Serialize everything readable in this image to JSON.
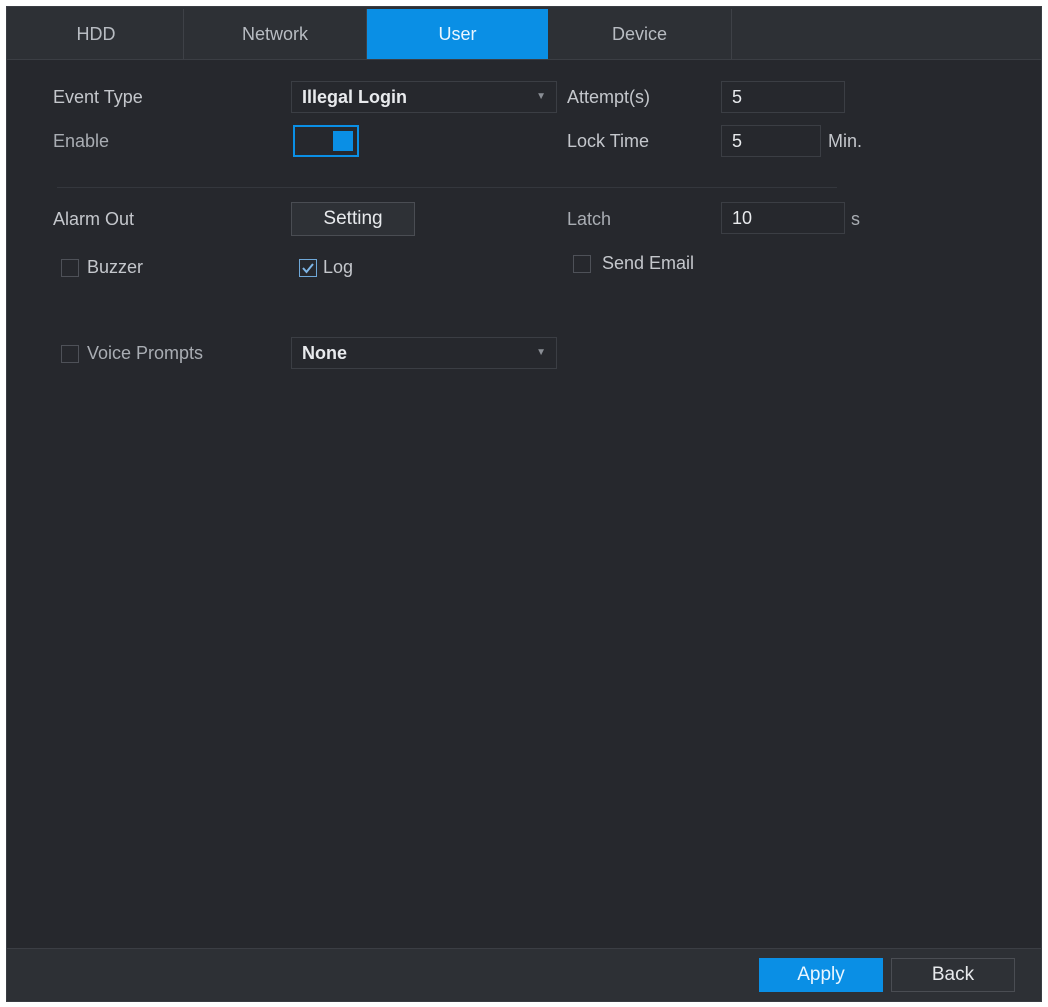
{
  "tabs": [
    {
      "label": "HDD"
    },
    {
      "label": "Network"
    },
    {
      "label": "User"
    },
    {
      "label": "Device"
    }
  ],
  "active_tab": "User",
  "form": {
    "event_type_label": "Event Type",
    "event_type_value": "Illegal Login",
    "attempts_label": "Attempt(s)",
    "attempts_value": "5",
    "enable_label": "Enable",
    "enable_on": true,
    "lock_time_label": "Lock Time",
    "lock_time_value": "5",
    "lock_time_unit": "Min.",
    "alarm_out_label": "Alarm Out",
    "setting_button": "Setting",
    "latch_label": "Latch",
    "latch_value": "10",
    "latch_unit": "s",
    "buzzer_label": "Buzzer",
    "buzzer_checked": false,
    "log_label": "Log",
    "log_checked": true,
    "send_email_label": "Send Email",
    "send_email_checked": false,
    "voice_prompts_label": "Voice Prompts",
    "voice_prompts_checked": false,
    "voice_prompts_value": "None"
  },
  "footer": {
    "apply_label": "Apply",
    "back_label": "Back"
  },
  "colors": {
    "accent": "#0a8fe5",
    "background": "#26282d"
  }
}
